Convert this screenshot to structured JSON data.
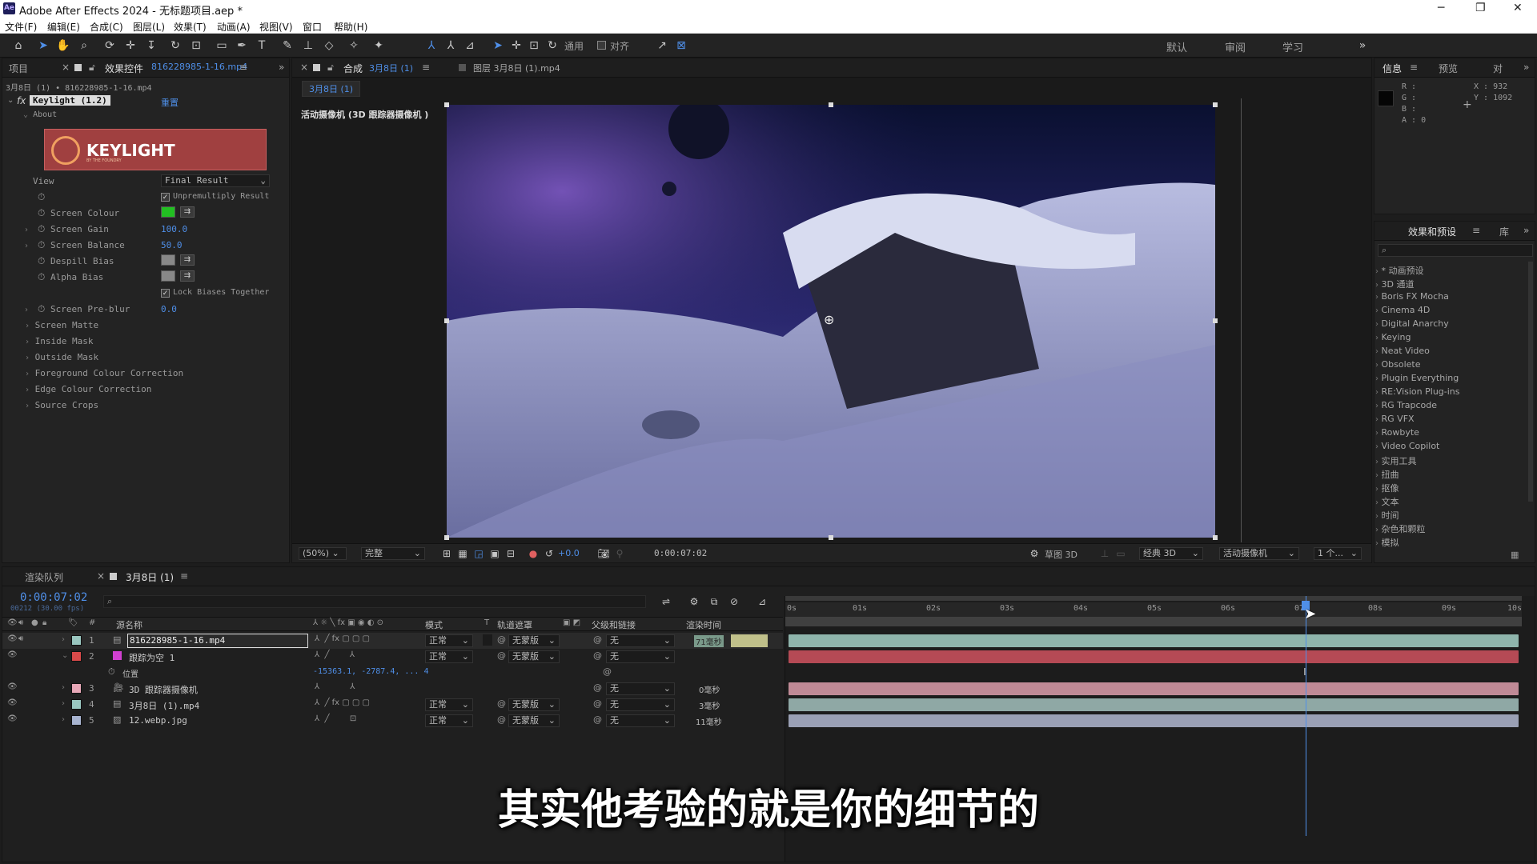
{
  "window": {
    "app_badge": "Ae",
    "title": "Adobe After Effects 2024 - 无标题项目.aep *"
  },
  "menu": [
    "文件(F)",
    "编辑(E)",
    "合成(C)",
    "图层(L)",
    "效果(T)",
    "动画(A)",
    "视图(V)",
    "窗口",
    "帮助(H)"
  ],
  "toolbar": {
    "snap_label": "通用",
    "align_label": "对齐",
    "workspaces": [
      "默认",
      "审阅",
      "学习"
    ]
  },
  "left_panel": {
    "tab_project": "项目",
    "tab_effects": "效果控件",
    "tab_effects_file": "816228985-1-16.mp4",
    "breadcrumb": "3月8日 (1) • 816228985-1-16.mp4",
    "effect_name": "Keylight (1.2)",
    "reset": "重置",
    "about": "About",
    "logo_text": "KEYLIGHT",
    "logo_sub": "BY THE FOUNDRY",
    "props": {
      "view_label": "View",
      "view_value": "Final Result",
      "unpremult": "Unpremultiply Result",
      "screen_colour": "Screen Colour",
      "screen_gain": "Screen Gain",
      "screen_gain_val": "100.0",
      "screen_balance": "Screen Balance",
      "screen_balance_val": "50.0",
      "despill": "Despill Bias",
      "alpha_bias": "Alpha Bias",
      "lock_biases": "Lock Biases Together",
      "preblur": "Screen Pre-blur",
      "preblur_val": "0.0",
      "screen_matte": "Screen Matte",
      "inside_mask": "Inside Mask",
      "outside_mask": "Outside Mask",
      "fg_colour": "Foreground Colour Correction",
      "edge_colour": "Edge Colour Correction",
      "source_crops": "Source Crops"
    }
  },
  "viewer": {
    "tab_comp": "合成",
    "tab_comp_name": "3月8日 (1)",
    "tab_layer": "图层 3月8日 (1).mp4",
    "comp_chip": "3月8日 (1)",
    "camera_label": "活动摄像机 (3D 跟踪器摄像机 )",
    "zoom": "(50%)",
    "quality": "完整",
    "exposure": "+0.0",
    "timecode": "0:00:07:02",
    "draft3d": "草图 3D",
    "renderer": "经典 3D",
    "camera": "活动摄像机",
    "views": "1 个..."
  },
  "info_panel": {
    "tab_info": "信息",
    "tab_preview": "预览",
    "tab_align": "对",
    "r": "R :",
    "g": "G :",
    "b": "B :",
    "a": "A : 0",
    "x": "X : 932",
    "y": "Y : 1092"
  },
  "effects_panel": {
    "tab": "效果和预设",
    "tab_lib": "库",
    "items": [
      "* 动画预设",
      "3D 通道",
      "Boris FX Mocha",
      "Cinema 4D",
      "Digital Anarchy",
      "Keying",
      "Neat Video",
      "Obsolete",
      "Plugin Everything",
      "RE:Vision Plug-ins",
      "RG Trapcode",
      "RG VFX",
      "Rowbyte",
      "Video Copilot",
      "实用工具",
      "扭曲",
      "抠像",
      "文本",
      "时间",
      "杂色和颗粒",
      "模拟"
    ]
  },
  "timeline": {
    "tab_render": "渲染队列",
    "tab_comp": "3月8日 (1)",
    "timecode": "0:00:07:02",
    "frame_info": "00212 (30.00 fps)",
    "headers": {
      "source": "源名称",
      "mode": "模式",
      "t": "T",
      "track": "轨道遮罩",
      "parent": "父级和链接",
      "render": "渲染时间"
    },
    "ruler": [
      "0s",
      "01s",
      "02s",
      "03s",
      "04s",
      "05s",
      "06s",
      "07s",
      "08s",
      "09s",
      "10s"
    ],
    "layers": [
      {
        "num": "1",
        "name": "816228985-1-16.mp4",
        "mode": "正常",
        "track": "无蒙版",
        "parent": "无",
        "render": "71毫秒",
        "color": "#9ac7c0",
        "bar": "#8fb5ac"
      },
      {
        "num": "2",
        "name": "跟踪为空 1",
        "mode": "正常",
        "track": "无蒙版",
        "parent": "无",
        "render": "",
        "color": "#d94a4a",
        "bar": "#b54a55"
      },
      {
        "num": "3",
        "name": "3D 跟踪器摄像机",
        "mode": "",
        "track": "",
        "parent": "无",
        "render": "0毫秒",
        "color": "#e8a8b8",
        "bar": "#c08a96"
      },
      {
        "num": "4",
        "name": "3月8日 (1).mp4",
        "mode": "正常",
        "track": "无蒙版",
        "parent": "无",
        "render": "3毫秒",
        "color": "#9ac7c0",
        "bar": "#8fa8a5"
      },
      {
        "num": "5",
        "name": "12.webp.jpg",
        "mode": "正常",
        "track": "无蒙版",
        "parent": "无",
        "render": "11毫秒",
        "color": "#a8b4d0",
        "bar": "#9aa0b5"
      }
    ],
    "position_label": "位置",
    "position_value": "-15363.1, -2787.4, ... 4",
    "playhead_fraction": 0.7067
  },
  "subtitle": "其实他考验的就是你的细节的",
  "colors": {
    "accent_blue": "#4f8fe8",
    "screen_colour": "#22c022",
    "keylight_bg": "#a04040"
  }
}
